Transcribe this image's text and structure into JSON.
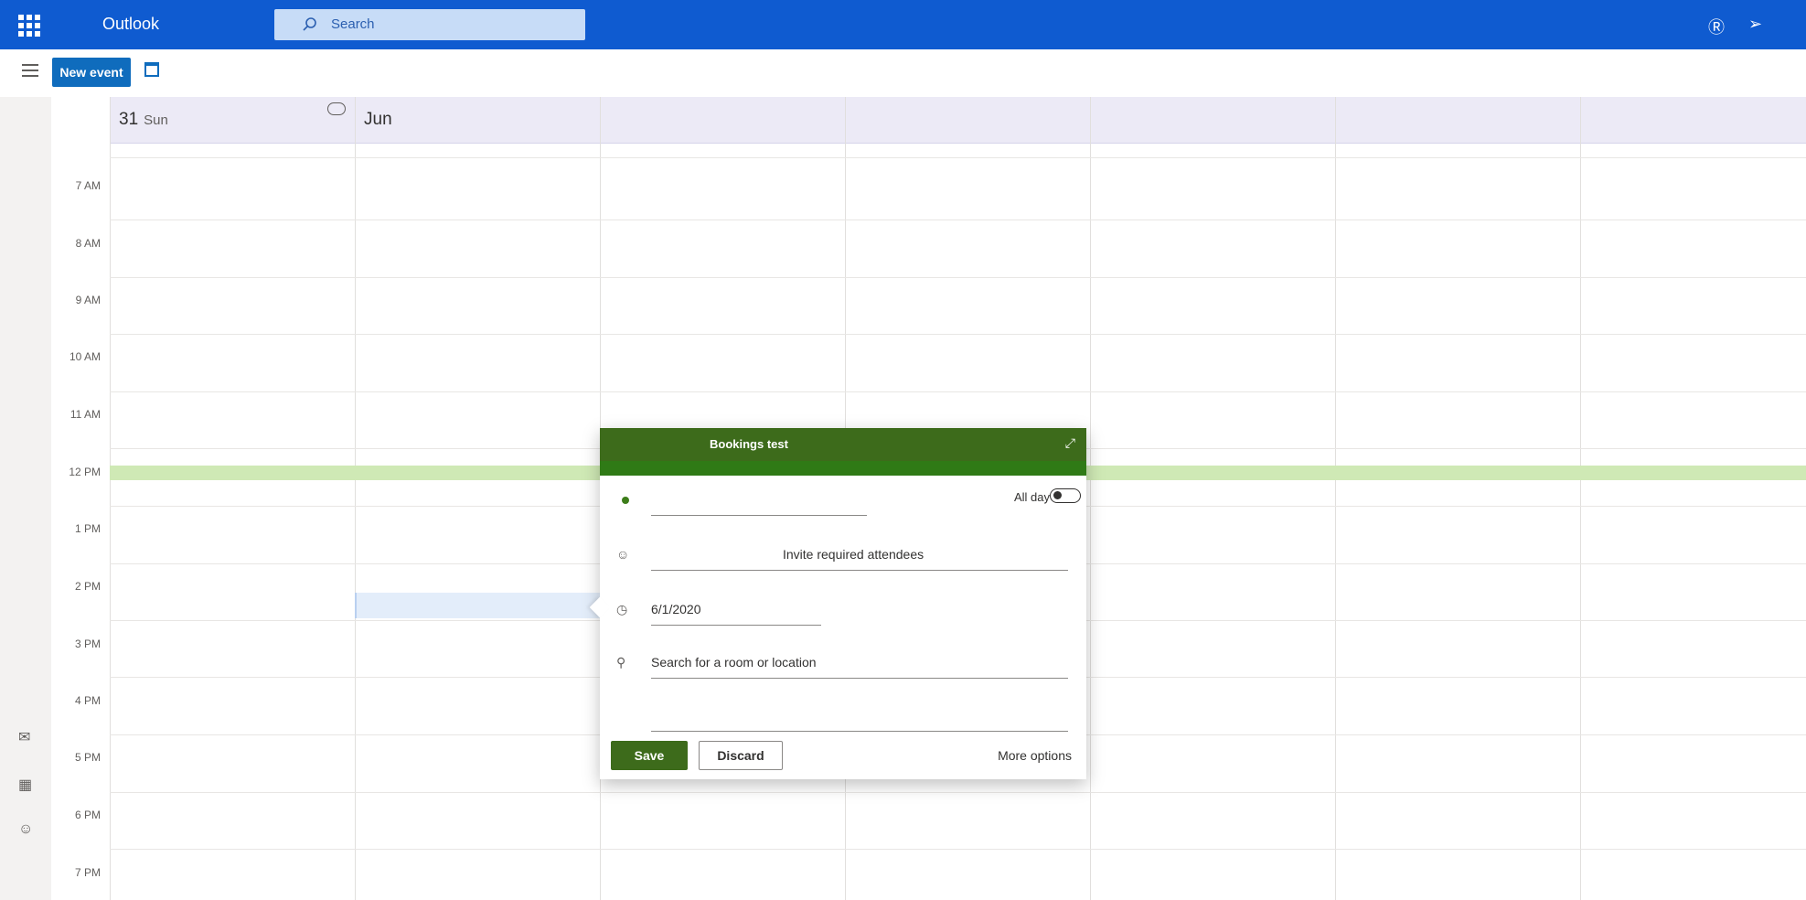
{
  "app": {
    "brand": "Outlook",
    "search_placeholder": "Search",
    "skype_icon": "skype-icon",
    "feedback_icon": "feedback-icon"
  },
  "toolbar": {
    "new_event_label": "New event",
    "view_icon": "calendar-view-icon"
  },
  "calendar": {
    "days": [
      {
        "number": "31",
        "name": "Sun"
      },
      {
        "label": "Jun"
      }
    ],
    "hours": [
      "7 AM",
      "8 AM",
      "9 AM",
      "10 AM",
      "11 AM",
      "12 PM",
      "1 PM",
      "2 PM",
      "3 PM",
      "4 PM",
      "5 PM",
      "6 PM",
      "7 PM"
    ]
  },
  "rail": {
    "items": [
      "mail-icon",
      "calendar-icon",
      "people-icon"
    ]
  },
  "popup": {
    "calendar_name": "Bookings test",
    "title_value": "",
    "all_day_label": "All day",
    "attendees_placeholder": "Invite required attendees",
    "date_value": "6/1/2020",
    "location_placeholder": "Search for a room or location",
    "save_label": "Save",
    "discard_label": "Discard",
    "more_options_label": "More options"
  },
  "colors": {
    "brand_blue": "#0f5bd0",
    "button_blue": "#0f6cbd",
    "event_green": "#3d6b1b"
  }
}
